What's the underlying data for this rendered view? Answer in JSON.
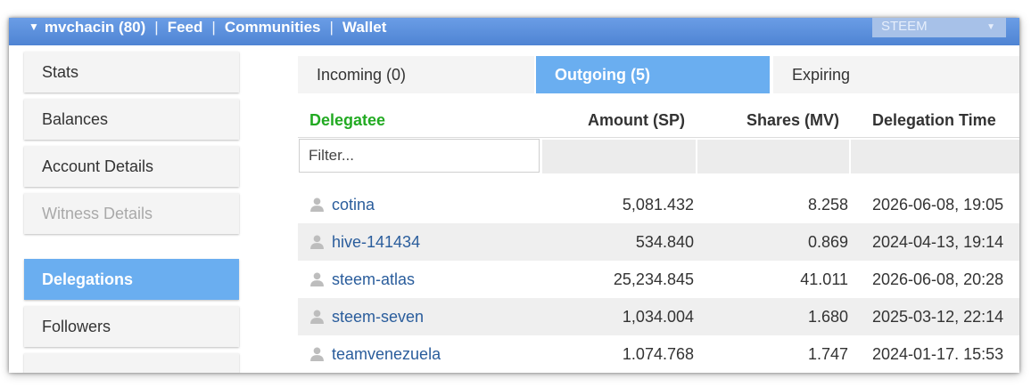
{
  "nav": {
    "account": "mvchacin (80)",
    "items": [
      "Feed",
      "Communities",
      "Wallet"
    ],
    "currency": "STEEM"
  },
  "sidebar": {
    "items": [
      {
        "label": "Stats",
        "state": "normal"
      },
      {
        "label": "Balances",
        "state": "normal"
      },
      {
        "label": "Account Details",
        "state": "normal"
      },
      {
        "label": "Witness Details",
        "state": "disabled"
      },
      {
        "label": "Delegations",
        "state": "active"
      },
      {
        "label": "Followers",
        "state": "normal"
      }
    ]
  },
  "tabs": [
    {
      "label": "Incoming (0)",
      "active": false
    },
    {
      "label": "Outgoing (5)",
      "active": true
    },
    {
      "label": "Expiring",
      "active": false
    }
  ],
  "table": {
    "headers": {
      "delegatee": "Delegatee",
      "amount": "Amount (SP)",
      "shares": "Shares (MV)",
      "time": "Delegation Time"
    },
    "filter_placeholder": "Filter...",
    "rows": [
      {
        "name": "cotina",
        "amount": "5,081.432",
        "shares": "8.258",
        "time": "2026-06-08, 19:05"
      },
      {
        "name": "hive-141434",
        "amount": "534.840",
        "shares": "0.869",
        "time": "2024-04-13, 19:14"
      },
      {
        "name": "steem-atlas",
        "amount": "25,234.845",
        "shares": "41.011",
        "time": "2026-06-08, 20:28"
      },
      {
        "name": "steem-seven",
        "amount": "1,034.004",
        "shares": "1.680",
        "time": "2025-03-12, 22:14"
      },
      {
        "name": "teamvenezuela",
        "amount": "1.074.768",
        "shares": "1.747",
        "time": "2024-01-17. 15:53"
      }
    ]
  },
  "colors": {
    "topbar": "#5b8fdc",
    "active": "#6aaef0",
    "link": "#2a5d9c",
    "delegatee_header": "#22aa22"
  }
}
